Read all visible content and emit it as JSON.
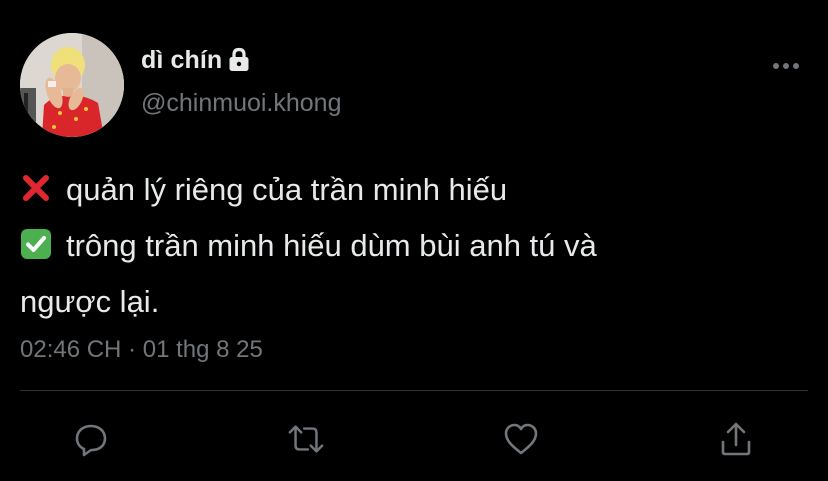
{
  "user": {
    "display_name": "dì chín",
    "handle": "@chinmuoi.khong",
    "protected_icon": "lock-icon"
  },
  "tweet": {
    "lines": [
      {
        "emoji": "cross-mark-emoji",
        "text": "quản lý riêng của trần minh hiếu"
      },
      {
        "emoji": "check-mark-button-emoji",
        "text": "trông trần minh hiếu dùm bùi anh tú và"
      },
      {
        "emoji": "",
        "text": "ngược lại."
      }
    ],
    "time": "02:46 CH",
    "separator": "·",
    "date": "01 thg 8 25"
  },
  "actions": [
    {
      "name": "reply-button",
      "icon": "speech-bubble-icon"
    },
    {
      "name": "retweet-button",
      "icon": "retweet-icon"
    },
    {
      "name": "like-button",
      "icon": "heart-icon"
    },
    {
      "name": "share-button",
      "icon": "share-icon"
    }
  ],
  "colors": {
    "background": "#000000",
    "primary_text": "#e7e9ea",
    "secondary_text": "#71767b",
    "divider": "#2f3336",
    "icon": "#71767b",
    "cross": "#e0262f",
    "check": "#4caf50"
  }
}
